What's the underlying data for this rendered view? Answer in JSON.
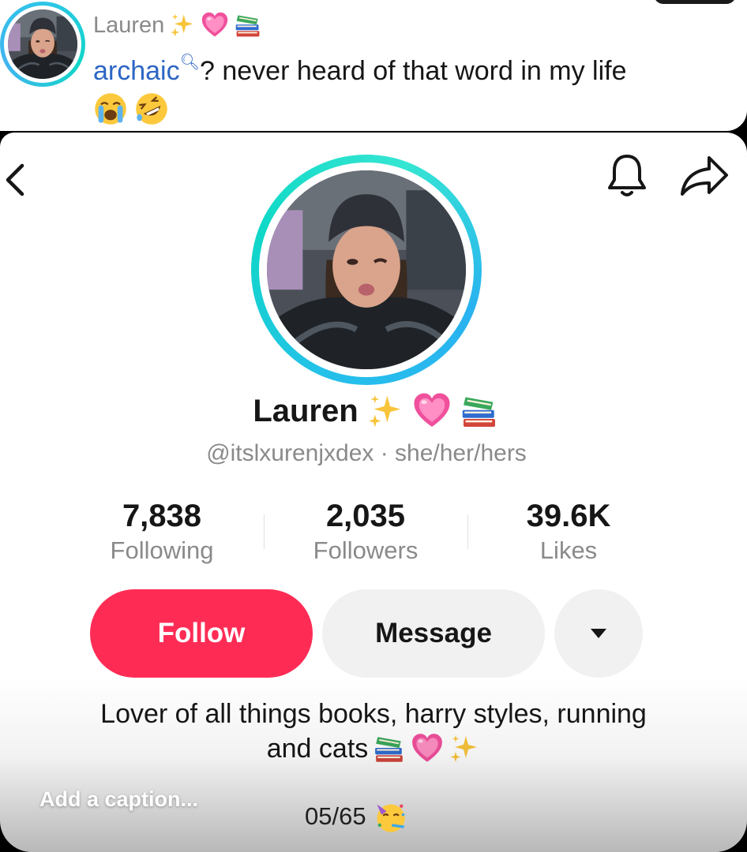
{
  "comment": {
    "author": "Lauren",
    "keyword": "archaic",
    "text": "? never heard of that word in my life",
    "author_emojis": [
      "sparkles-icon",
      "heart-icon",
      "books-icon"
    ],
    "reaction_emojis": [
      "loudly-crying-face-icon",
      "rolling-laughing-face-icon"
    ]
  },
  "profile": {
    "name": "Lauren",
    "name_emojis": [
      "sparkles-icon",
      "heart-icon",
      "books-icon"
    ],
    "handle": "@itslxurenjxdex · she/her/hers",
    "stats": [
      {
        "value": "7,838",
        "label": "Following"
      },
      {
        "value": "2,035",
        "label": "Followers"
      },
      {
        "value": "39.6K",
        "label": "Likes"
      }
    ],
    "buttons": {
      "follow": "Follow",
      "message": "Message"
    },
    "bio_line1": "Lover of all things books, harry styles, running",
    "bio_line2": "and cats"
  },
  "editor": {
    "caption_placeholder": "Add a caption...",
    "counter": "05/65"
  },
  "colors": {
    "follow_button": "#fe2c55",
    "story_ring": "#25c0ea",
    "keyword_link": "#2d66c4"
  }
}
